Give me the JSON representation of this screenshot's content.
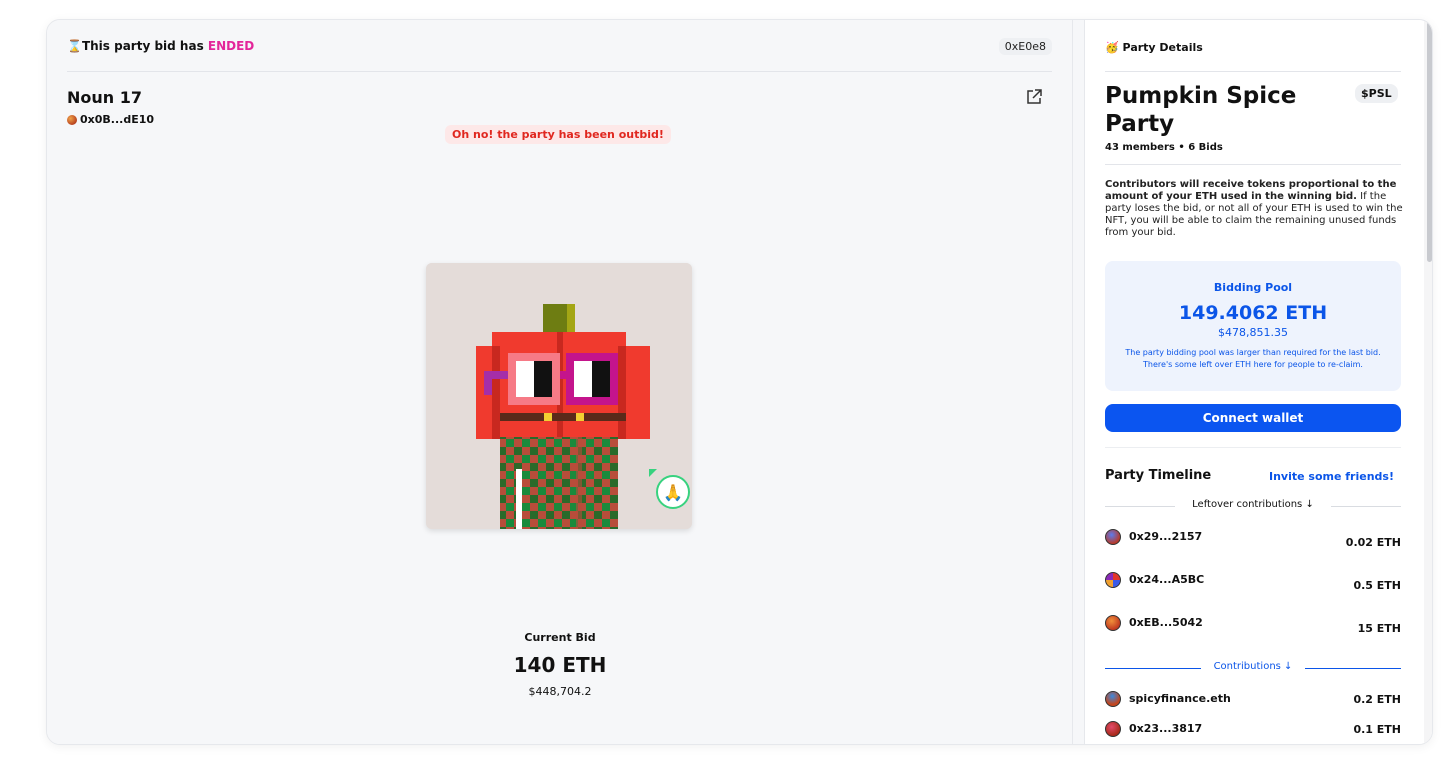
{
  "status": {
    "icon": "hourglass-icon",
    "prefix": "This party bid has ",
    "state": "ENDED",
    "address": "0xE0e8"
  },
  "nft": {
    "title": "Noun 17",
    "owner": "0x0B...dE10",
    "outbid_notice": "Oh no! the party has been outbid!",
    "current_bid_label": "Current Bid",
    "current_bid_value": "140 ETH",
    "current_bid_usd": "$448,704.2",
    "reaction_emoji": "🙏"
  },
  "party": {
    "header_emoji": "🥳",
    "header": "Party Details",
    "name": "Pumpkin Spice Party",
    "symbol": "$PSL",
    "members": "43 members • 6 Bids",
    "info_bold": "Contributors will receive tokens proportional to the amount of your ETH used in the winning bid.",
    "info_rest": " If the party loses the bid, or not all of your ETH is used to win the NFT, you will be able to claim the remaining unused funds from your bid.",
    "pool": {
      "title": "Bidding Pool",
      "eth": "149.4062 ETH",
      "usd": "$478,851.35",
      "note": "The party bidding pool was larger than required for the last bid. There's some left over ETH here for people to re-claim."
    },
    "connect_label": "Connect wallet",
    "timeline_title": "Party Timeline",
    "invite_label": "Invite some friends!",
    "leftover_label": "Leftover contributions ↓",
    "leftover": [
      {
        "name": "0x29...2157",
        "amount": "0.02 ETH"
      },
      {
        "name": "0x24...A5BC",
        "amount": "0.5 ETH"
      },
      {
        "name": "0xEB...5042",
        "amount": "15 ETH"
      }
    ],
    "contributions_label": "Contributions ↓",
    "contributions": [
      {
        "name": "spicyfinance.eth",
        "amount": "0.2 ETH"
      },
      {
        "name": "0x23...3817",
        "amount": "0.1 ETH"
      }
    ]
  },
  "colors": {
    "accent_blue": "#0b55e8",
    "ended_pink": "#e3269a",
    "outbid_red": "#e0271f"
  }
}
